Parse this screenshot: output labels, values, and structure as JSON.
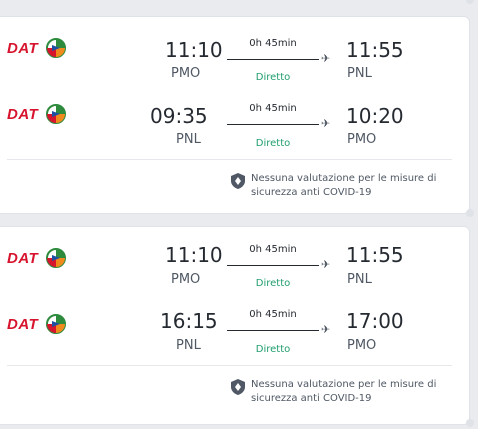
{
  "itineraries": [
    {
      "legs": [
        {
          "airline": "DAT",
          "dep_time": "11:10",
          "dep_code": "PMO",
          "duration": "0h 45min",
          "stops": "Diretto",
          "arr_time": "11:55",
          "arr_code": "PNL"
        },
        {
          "airline": "DAT",
          "dep_time": "09:35",
          "dep_code": "PNL",
          "duration": "0h 45min",
          "stops": "Diretto",
          "arr_time": "10:20",
          "arr_code": "PMO"
        }
      ],
      "covid_note": [
        "Nessuna valutazione per le misure di",
        "sicurezza anti COVID-19"
      ]
    },
    {
      "legs": [
        {
          "airline": "DAT",
          "dep_time": "11:10",
          "dep_code": "PMO",
          "duration": "0h 45min",
          "stops": "Diretto",
          "arr_time": "11:55",
          "arr_code": "PNL"
        },
        {
          "airline": "DAT",
          "dep_time": "16:15",
          "dep_code": "PNL",
          "duration": "0h 45min",
          "stops": "Diretto",
          "arr_time": "17:00",
          "arr_code": "PMO"
        }
      ],
      "covid_note": [
        "Nessuna valutazione per le misure di",
        "sicurezza anti COVID-19"
      ]
    }
  ],
  "colors": {
    "airline_red": "#d7142d",
    "direct_green": "#1f9e6e",
    "text_dark": "#252a31",
    "text_muted": "#4f5864"
  },
  "icons": {
    "airline_logo": "dat-logo-icon",
    "plane": "plane-icon",
    "shield": "shield-icon"
  }
}
